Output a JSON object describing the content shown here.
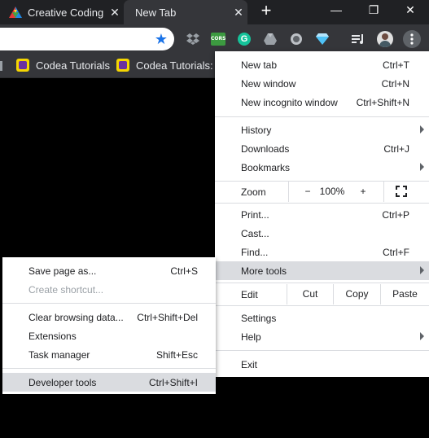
{
  "tabs": [
    {
      "title": "Creative Coding",
      "close": "✕"
    },
    {
      "title": "New Tab",
      "close": "✕"
    }
  ],
  "window": {
    "new_tab": "+",
    "minimize": "—",
    "restore": "❐",
    "close": "✕"
  },
  "toolbar": {
    "extension_icons": [
      "dropbox-icon",
      "cors-icon",
      "grammarly-icon",
      "drive-icon",
      "record-icon",
      "diamond-icon",
      "media-icon",
      "profile-avatar",
      "menu-dots-icon"
    ],
    "cors_label": "CORS"
  },
  "bookmarks": [
    {
      "label": "Codea Tutorials"
    },
    {
      "label": "Codea Tutorials: T"
    }
  ],
  "menu": {
    "new_tab": {
      "label": "New tab",
      "shortcut": "Ctrl+T"
    },
    "new_window": {
      "label": "New window",
      "shortcut": "Ctrl+N"
    },
    "incognito": {
      "label": "New incognito window",
      "shortcut": "Ctrl+Shift+N"
    },
    "history": {
      "label": "History"
    },
    "downloads": {
      "label": "Downloads",
      "shortcut": "Ctrl+J"
    },
    "bookmarks": {
      "label": "Bookmarks"
    },
    "zoom": {
      "label": "Zoom",
      "minus": "−",
      "value": "100%",
      "plus": "+"
    },
    "print": {
      "label": "Print...",
      "shortcut": "Ctrl+P"
    },
    "cast": {
      "label": "Cast..."
    },
    "find": {
      "label": "Find...",
      "shortcut": "Ctrl+F"
    },
    "more_tools": {
      "label": "More tools"
    },
    "edit": {
      "label": "Edit",
      "cut": "Cut",
      "copy": "Copy",
      "paste": "Paste"
    },
    "settings": {
      "label": "Settings"
    },
    "help": {
      "label": "Help"
    },
    "exit": {
      "label": "Exit"
    }
  },
  "submenu": {
    "save_page": {
      "label": "Save page as...",
      "shortcut": "Ctrl+S"
    },
    "create_shortcut": {
      "label": "Create shortcut..."
    },
    "clear_data": {
      "label": "Clear browsing data...",
      "shortcut": "Ctrl+Shift+Del"
    },
    "extensions": {
      "label": "Extensions"
    },
    "task_manager": {
      "label": "Task manager",
      "shortcut": "Shift+Esc"
    },
    "dev_tools": {
      "label": "Developer tools",
      "shortcut": "Ctrl+Shift+I"
    }
  },
  "colors": {
    "accent": "#1a73e8",
    "tab_bg": "#202124",
    "toolbar_bg": "#35363a",
    "highlight": "#dadce0"
  }
}
